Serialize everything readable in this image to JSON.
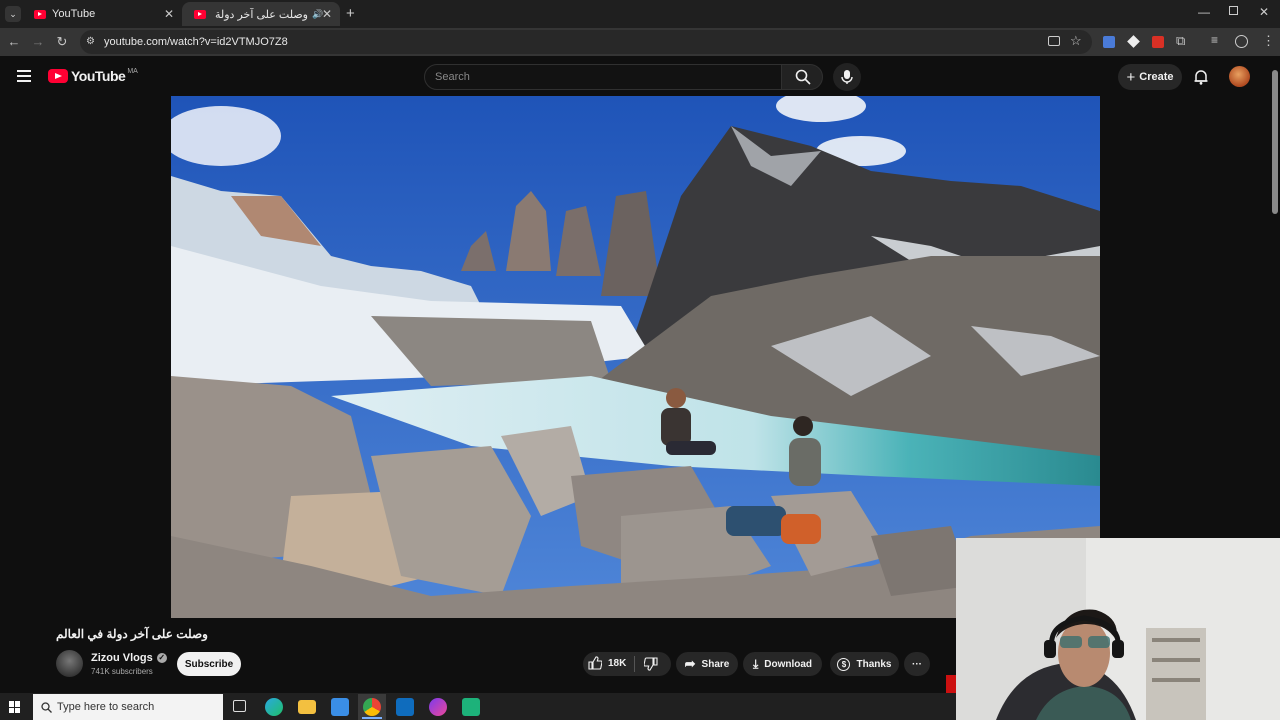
{
  "browser": {
    "tabs": [
      {
        "title": "YouTube",
        "active": false
      },
      {
        "title": "وصلت على آخر دولة في الع",
        "active": true
      }
    ],
    "url": "youtube.com/watch?v=id2VTMJO7Z8",
    "icons": [
      "back-icon",
      "forward-icon",
      "reload-icon",
      "site-info-icon",
      "cast-icon",
      "bookmark-star-icon",
      "extensions-icon",
      "profile-icon",
      "menu-icon"
    ]
  },
  "youtube": {
    "logo_text": "YouTube",
    "region": "MA",
    "search_placeholder": "Search",
    "create_label": "Create"
  },
  "video": {
    "title": "وصلت على آخر دولة في العالم",
    "channel_name": "Zizou Vlogs",
    "subscribers": "741K subscribers",
    "subscribe_label": "Subscribe",
    "like_count": "18K",
    "share_label": "Share",
    "download_label": "Download",
    "thanks_label": "Thanks",
    "more_label": "···"
  },
  "taskbar": {
    "search_placeholder": "Type here to search"
  },
  "colors": {
    "brand_red": "#ff0033",
    "background": "#0f0f0f",
    "pill": "#272727"
  }
}
